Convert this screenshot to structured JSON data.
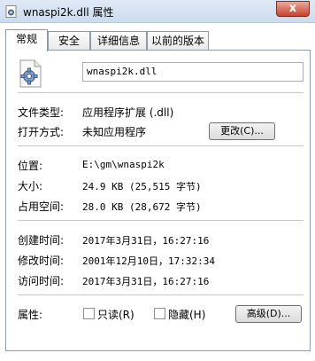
{
  "window": {
    "title": "wnaspi2k.dll 属性",
    "close_label": "x"
  },
  "tabs": [
    {
      "label": "常规",
      "active": true
    },
    {
      "label": "安全",
      "active": false
    },
    {
      "label": "详细信息",
      "active": false
    },
    {
      "label": "以前的版本",
      "active": false
    }
  ],
  "general": {
    "file_name": "wnaspi2k.dll",
    "file_type_label": "文件类型:",
    "file_type_value": "应用程序扩展 (.dll)",
    "opens_with_label": "打开方式:",
    "opens_with_value": "未知应用程序",
    "change_button": "更改(C)...",
    "location_label": "位置:",
    "location_value": "E:\\gm\\wnaspi2k",
    "size_label": "大小:",
    "size_value": "24.9 KB (25,515 字节)",
    "size_on_disk_label": "占用空间:",
    "size_on_disk_value": "28.0 KB (28,672 字节)",
    "created_label": "创建时间:",
    "created_value": "2017年3月31日，16:27:16",
    "modified_label": "修改时间:",
    "modified_value": "2001年12月10日，17:32:34",
    "accessed_label": "访问时间:",
    "accessed_value": "2017年3月31日，16:27:16",
    "attributes_label": "属性:",
    "readonly_label": "只读(R)",
    "hidden_label": "隐藏(H)",
    "advanced_button": "高级(D)..."
  },
  "colors": {
    "title_gradient_top": "#dfe9f5",
    "close_button": "#c7432c",
    "panel_border": "#8e9aa6"
  },
  "icons": {
    "app": "gear-file-icon",
    "file": "dll-gear-file-icon"
  }
}
